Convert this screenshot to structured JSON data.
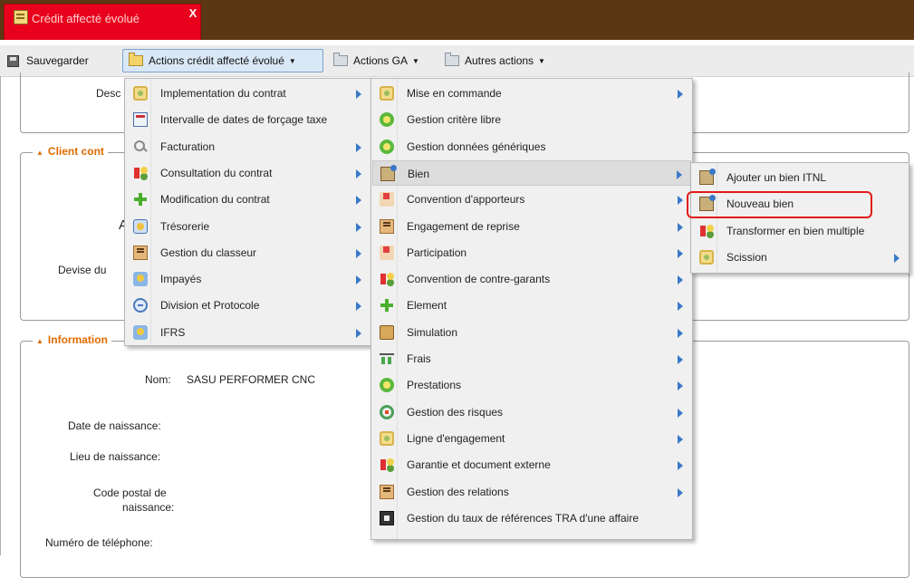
{
  "tab": {
    "title": "Crédit affecté évolué",
    "close": "X"
  },
  "toolbar": {
    "save_label": "Sauvegarder",
    "actions_credit_label": "Actions crédit affecté évolué",
    "actions_ga_label": "Actions GA",
    "autres_actions_label": "Autres actions",
    "caret": "▼"
  },
  "form": {
    "desc_label": "Desc",
    "client_legend": "Client cont",
    "a_label": "A",
    "devise_label": "Devise du",
    "info_legend": "Information",
    "nom_label": "Nom:",
    "nom_value": "SASU PERFORMER CNC",
    "date_naissance_label": "Date de naissance:",
    "lieu_naissance_label": "Lieu de naissance:",
    "code_postal_label_1": "Code postal de",
    "code_postal_label_2": "naissance:",
    "telephone_label": "Numéro de téléphone:",
    "collapse_glyph": "▲"
  },
  "menu1": {
    "items": [
      {
        "label": "Implementation du contrat",
        "icon": "gear-icon",
        "submenu": true
      },
      {
        "label": "Intervalle de dates de forçage taxe",
        "icon": "calendar-icon",
        "submenu": false
      },
      {
        "label": "Facturation",
        "icon": "magnifier-icon",
        "submenu": true
      },
      {
        "label": "Consultation du contrat",
        "icon": "contract-icon",
        "submenu": true
      },
      {
        "label": "Modification du contrat",
        "icon": "plus-icon",
        "submenu": true
      },
      {
        "label": "Trésorerie",
        "icon": "treasury-icon",
        "submenu": true
      },
      {
        "label": "Gestion du classeur",
        "icon": "binder-icon",
        "submenu": true
      },
      {
        "label": "Impayés",
        "icon": "unpaid-icon",
        "submenu": true
      },
      {
        "label": "Division et Protocole",
        "icon": "division-icon",
        "submenu": true
      },
      {
        "label": "IFRS",
        "icon": "ifrs-icon",
        "submenu": true
      }
    ]
  },
  "menu2": {
    "items": [
      {
        "label": "Mise en commande",
        "icon": "gear-icon",
        "submenu": true
      },
      {
        "label": "Gestion critère libre",
        "icon": "green-circle-icon",
        "submenu": false
      },
      {
        "label": "Gestion données génériques",
        "icon": "green-circle-icon",
        "submenu": false
      },
      {
        "label": "Bien",
        "icon": "asset-icon",
        "submenu": true,
        "highlighted": true
      },
      {
        "label": "Convention d'apporteurs",
        "icon": "handshake-icon",
        "submenu": true
      },
      {
        "label": "Engagement de reprise",
        "icon": "binder-icon",
        "submenu": true
      },
      {
        "label": "Participation",
        "icon": "handshake-icon",
        "submenu": true
      },
      {
        "label": "Convention de contre-garants",
        "icon": "contract-icon",
        "submenu": true
      },
      {
        "label": "Element",
        "icon": "plus-icon",
        "submenu": true
      },
      {
        "label": "Simulation",
        "icon": "simulation-icon",
        "submenu": true
      },
      {
        "label": "Frais",
        "icon": "fees-icon",
        "submenu": true
      },
      {
        "label": "Prestations",
        "icon": "green-circle-icon",
        "submenu": true
      },
      {
        "label": "Gestion des risques",
        "icon": "risk-icon",
        "submenu": true
      },
      {
        "label": "Ligne d'engagement",
        "icon": "gear-icon",
        "submenu": true
      },
      {
        "label": "Garantie et document externe",
        "icon": "contract-icon",
        "submenu": true
      },
      {
        "label": "Gestion des relations",
        "icon": "binder-icon",
        "submenu": true
      },
      {
        "label": "Gestion du taux de références TRA d'une affaire",
        "icon": "rate-icon",
        "submenu": false
      }
    ]
  },
  "menu3": {
    "items": [
      {
        "label": "Ajouter un bien ITNL",
        "icon": "asset-icon",
        "submenu": false
      },
      {
        "label": "Nouveau bien",
        "icon": "asset-icon",
        "submenu": false,
        "annotated": true
      },
      {
        "label": "Transformer en bien multiple",
        "icon": "contract-icon",
        "submenu": false
      },
      {
        "label": "Scission",
        "icon": "gear-icon",
        "submenu": true
      }
    ]
  },
  "colors": {
    "accent": "#e06a00",
    "tab_red": "#e8001c",
    "header_brown": "#5b3714",
    "annotation_red": "#e11a1a",
    "arrow_blue": "#3a78c8"
  }
}
